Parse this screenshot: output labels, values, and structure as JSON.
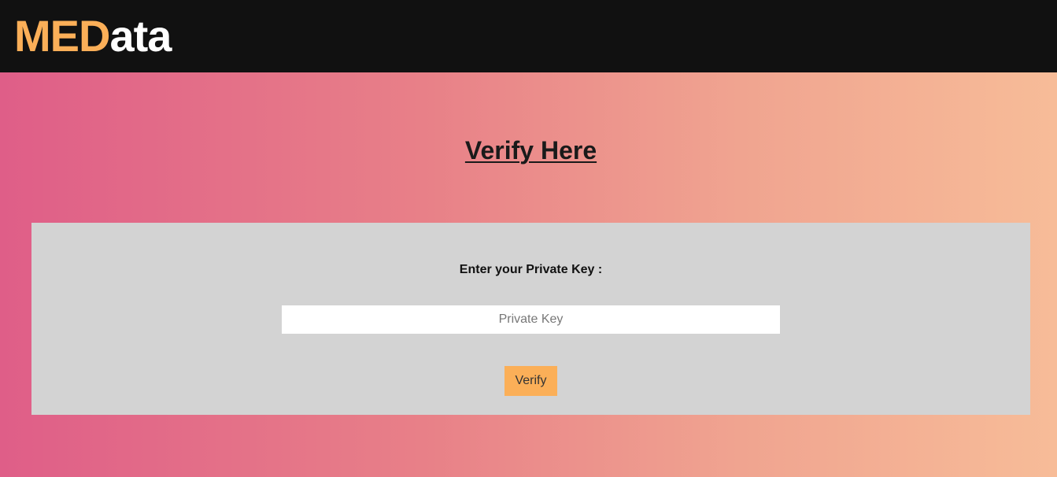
{
  "header": {
    "logo_accent": "MED",
    "logo_rest": "ata",
    "colors": {
      "background": "#111111",
      "accent": "#fbaf58",
      "text": "#ffffff"
    }
  },
  "main": {
    "title": "Verify Here",
    "form": {
      "label": "Enter your Private Key :",
      "input_placeholder": "Private Key",
      "input_value": "",
      "submit_label": "Verify",
      "colors": {
        "panel": "#d3d3d3",
        "button": "#fbaf58"
      }
    }
  },
  "background": {
    "gradient_start": "#df5e88",
    "gradient_end": "#f7bc98"
  }
}
